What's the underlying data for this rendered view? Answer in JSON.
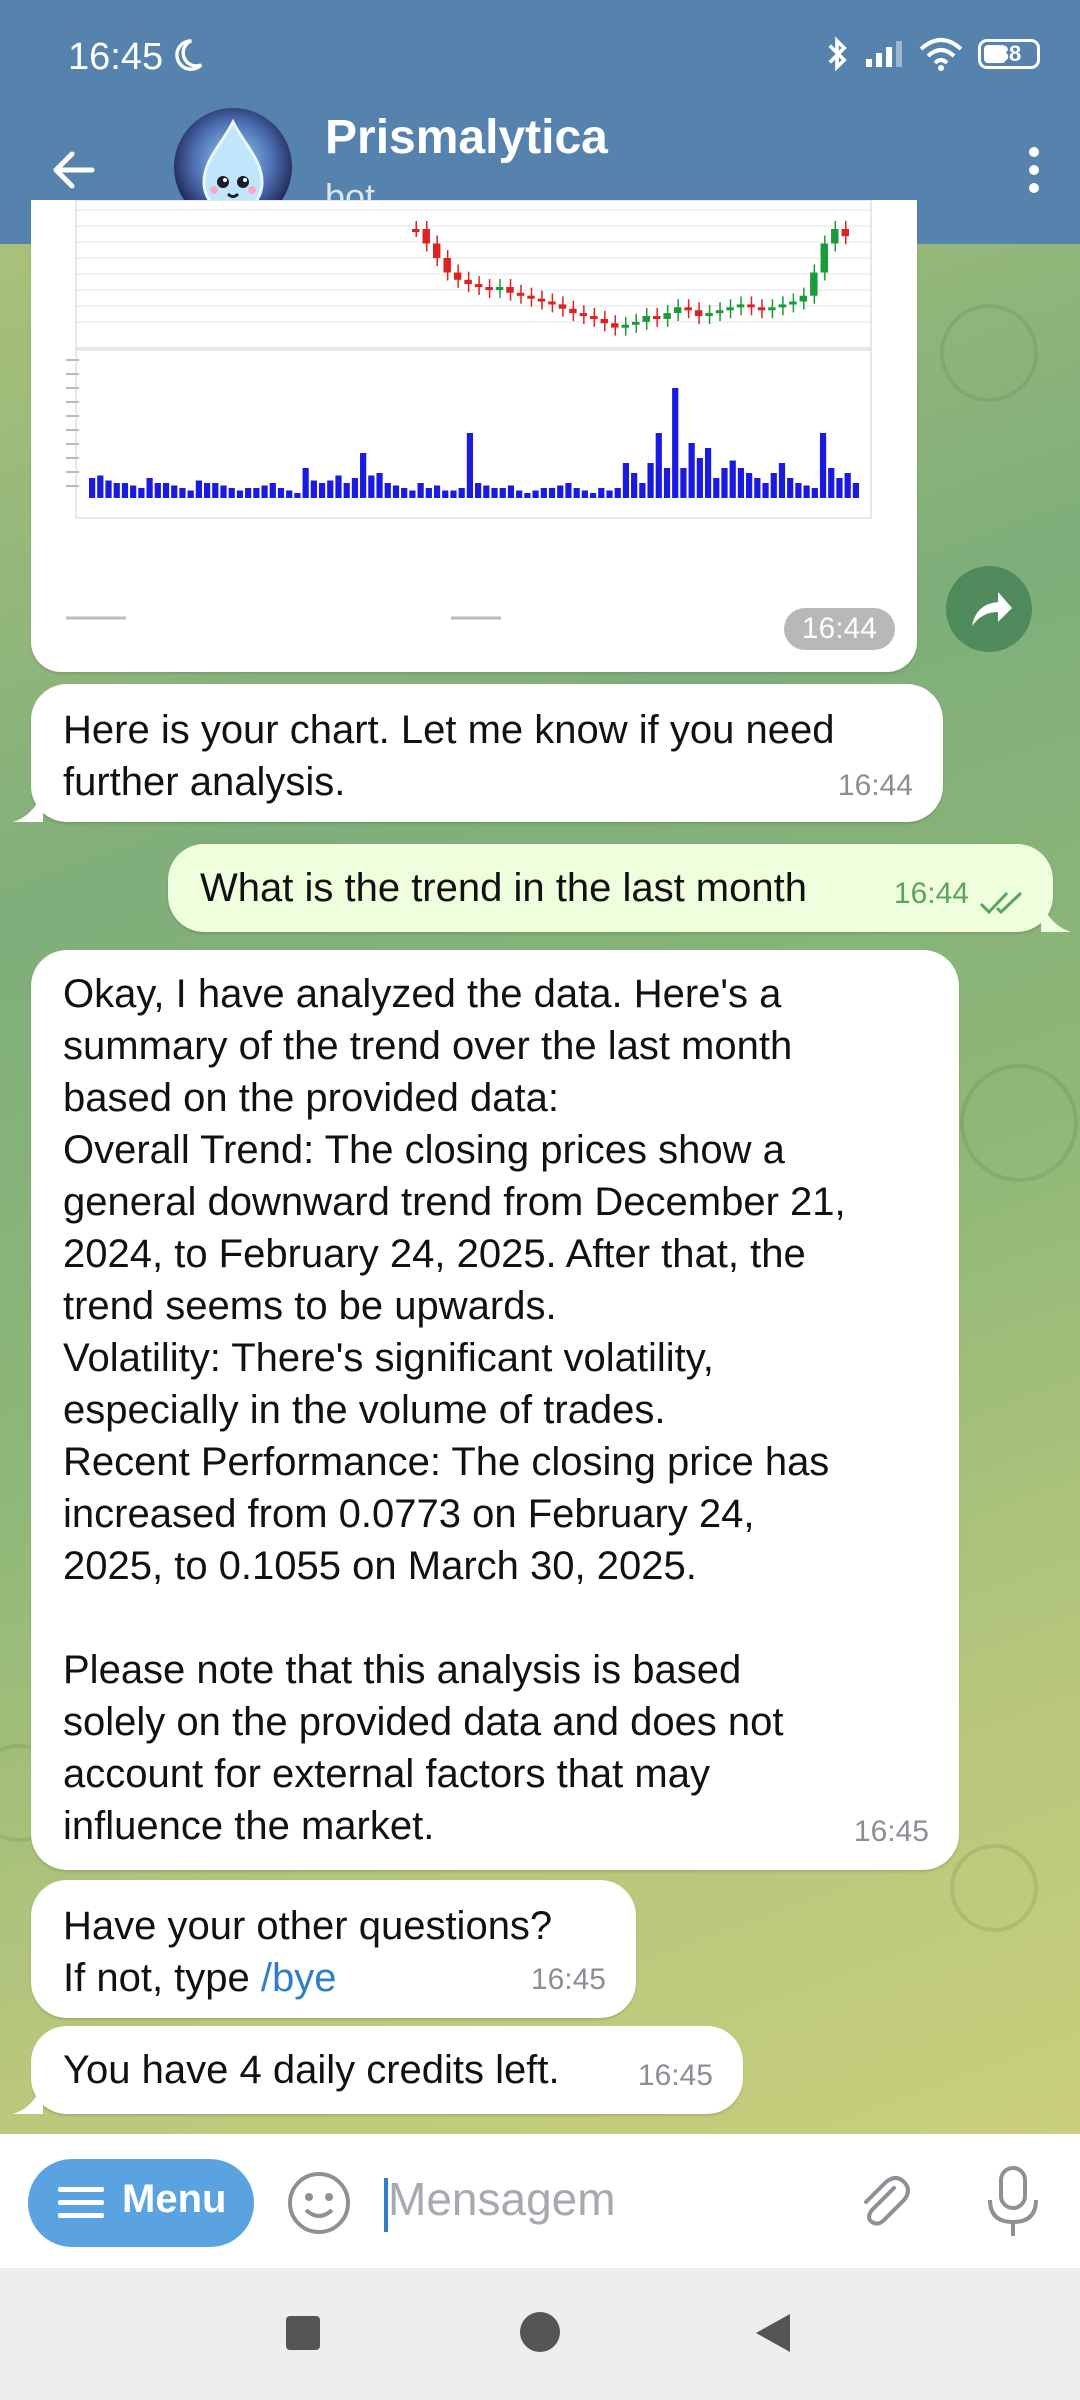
{
  "status": {
    "time": "16:45",
    "battery": "38"
  },
  "header": {
    "title": "Prismalytica",
    "subtitle": "bot"
  },
  "messages": {
    "chart_time": "16:44",
    "m1": {
      "text": "Here is your chart. Let me know if you need further analysis.",
      "time": "16:44"
    },
    "m2": {
      "text": "What is the trend in the last month",
      "time": "16:44"
    },
    "m3": {
      "lines": [
        "Okay, I have analyzed the data. Here's a",
        "summary of the trend over the last month",
        "based on the provided data:",
        "Overall Trend: The closing prices show a",
        "general downward trend from December 21,",
        "2024, to February 24, 2025. After that, the",
        "trend seems to be upwards.",
        "Volatility: There's significant volatility,",
        "especially in the volume of trades.",
        "Recent Performance: The closing price has",
        "increased from 0.0773 on February 24,",
        "2025, to 0.1055 on March 30, 2025.",
        "",
        "Please note that this analysis is based",
        "solely on the provided data and does not",
        "account for external factors that may",
        "influence the market."
      ],
      "time": "16:45"
    },
    "m4": {
      "line1": "Have your other questions?",
      "line2_prefix": "If not, type ",
      "command": "/bye",
      "time": "16:45"
    },
    "m5": {
      "text": "You have 4 daily credits left.",
      "time": "16:45"
    }
  },
  "input": {
    "menu_label": "Menu",
    "placeholder": "Mensagem"
  },
  "colors": {
    "header": "#5683ad",
    "outgoing_bubble": "#effedd",
    "menu_button": "#5aa2e0",
    "link": "#2f7ec7"
  },
  "icons": [
    "moon-icon",
    "bluetooth-icon",
    "signal-icon",
    "wifi-icon",
    "battery-icon",
    "back-arrow-icon",
    "more-vert-icon",
    "share-icon",
    "smile-icon",
    "attach-icon",
    "mic-icon",
    "read-check-icon"
  ],
  "chart_data": {
    "type": "candlestick",
    "panels": [
      "price",
      "volume"
    ],
    "price_trend": "downward then upward",
    "volume_series": [
      8,
      9,
      7,
      6,
      6,
      5,
      4,
      8,
      6,
      6,
      5,
      4,
      3,
      7,
      6,
      6,
      5,
      4,
      3,
      4,
      4,
      5,
      6,
      4,
      3,
      2,
      12,
      7,
      6,
      7,
      9,
      6,
      8,
      18,
      9,
      10,
      6,
      5,
      4,
      3,
      6,
      4,
      5,
      3,
      3,
      4,
      26,
      6,
      5,
      4,
      4,
      5,
      3,
      2,
      3,
      4,
      4,
      5,
      6,
      4,
      3,
      2,
      4,
      3,
      4,
      14,
      10,
      6,
      14,
      26,
      12,
      44,
      12,
      22,
      16,
      20,
      8,
      12,
      15,
      12,
      10,
      8,
      6,
      10,
      14,
      8,
      6,
      5,
      4,
      26,
      12,
      8,
      10,
      6
    ]
  }
}
